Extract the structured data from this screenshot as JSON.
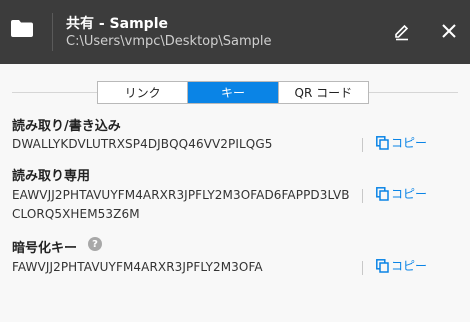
{
  "header": {
    "title": "共有 - Sample",
    "path": "C:\\Users\\vmpc\\Desktop\\Sample"
  },
  "tabs": [
    {
      "label": "リンク",
      "active": false
    },
    {
      "label": "キー",
      "active": true
    },
    {
      "label": "QR コード",
      "active": false
    }
  ],
  "sections": {
    "read_write": {
      "title": "読み取り/書き込み",
      "key": "DWALLYKDVLUTRXSP4DJBQQ46VV2PILQG5"
    },
    "read_only": {
      "title": "読み取り専用",
      "key_line1": "EAWVJJ2PHTAVUYFM4ARXR3JPFLY2M3OFAD6FAPPD3LVB",
      "key_line2": "CLORQ5XHEM53Z6M"
    },
    "encryption": {
      "title": "暗号化キー",
      "key": "FAWVJJ2PHTAVUYFM4ARXR3JPFLY2M3OFA"
    }
  },
  "copy_label": "コピー",
  "help_glyph": "?",
  "colors": {
    "header_bg": "#3c3c3c",
    "accent": "#0a84e6",
    "background": "#f8f8f8"
  }
}
